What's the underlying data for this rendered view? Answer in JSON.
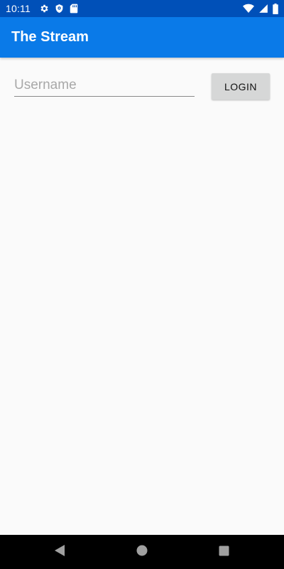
{
  "status_bar": {
    "time": "10:11",
    "icons": [
      "gear-icon",
      "shield-icon",
      "sd-card-icon",
      "wifi-icon",
      "signal-icon",
      "battery-icon"
    ],
    "background": "#0050b8"
  },
  "app_bar": {
    "title": "The Stream",
    "background": "#0a7ae8"
  },
  "login": {
    "username_placeholder": "Username",
    "username_value": "",
    "button_label": "LOGIN"
  },
  "nav_bar": {
    "icons": [
      "back-icon",
      "home-icon",
      "recents-icon"
    ]
  }
}
